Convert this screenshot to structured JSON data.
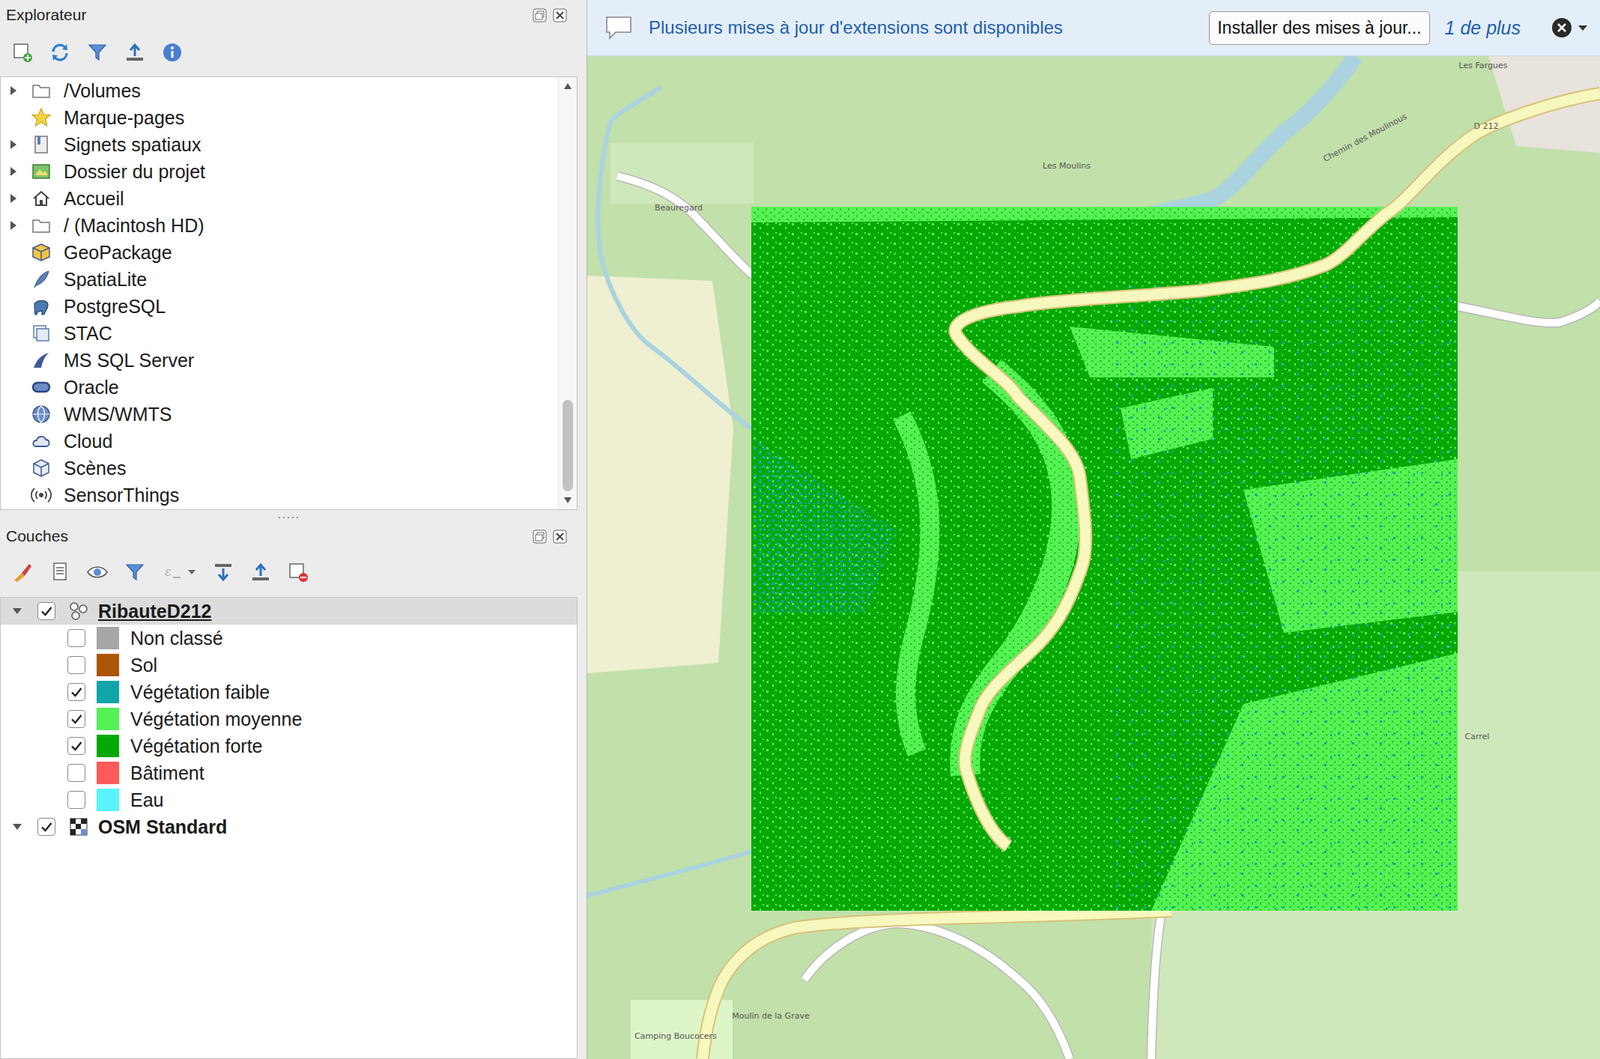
{
  "notification": {
    "message": "Plusieurs mises à jour d'extensions sont disponibles",
    "button": "Installer des mises à jour...",
    "more": "1 de plus"
  },
  "explorer": {
    "title": "Explorateur",
    "items": [
      {
        "label": "/Volumes",
        "expandable": true
      },
      {
        "label": "Marque-pages",
        "expandable": false
      },
      {
        "label": "Signets spatiaux",
        "expandable": true
      },
      {
        "label": "Dossier du projet",
        "expandable": true
      },
      {
        "label": "Accueil",
        "expandable": true
      },
      {
        "label": "/ (Macintosh HD)",
        "expandable": true
      },
      {
        "label": "GeoPackage",
        "expandable": false
      },
      {
        "label": "SpatiaLite",
        "expandable": false
      },
      {
        "label": "PostgreSQL",
        "expandable": false
      },
      {
        "label": "STAC",
        "expandable": false
      },
      {
        "label": "MS SQL Server",
        "expandable": false
      },
      {
        "label": "Oracle",
        "expandable": false
      },
      {
        "label": "WMS/WMTS",
        "expandable": false
      },
      {
        "label": "Cloud",
        "expandable": false
      },
      {
        "label": "Scènes",
        "expandable": false
      },
      {
        "label": "SensorThings",
        "expandable": false
      }
    ],
    "scrollbar": {
      "offset": 0.77,
      "size": 0.23
    }
  },
  "layers_panel": {
    "title": "Couches"
  },
  "layers": [
    {
      "name": "RibauteD212",
      "checked": true,
      "expanded": true,
      "selected": true,
      "current": true,
      "classes": [
        {
          "name": "Non classé",
          "checked": false,
          "color": "#a6a6a6"
        },
        {
          "name": "Sol",
          "checked": false,
          "color": "#ab5607"
        },
        {
          "name": "Végétation faible",
          "checked": true,
          "color": "#10a5a8"
        },
        {
          "name": "Végétation moyenne",
          "checked": true,
          "color": "#55f255"
        },
        {
          "name": "Végétation forte",
          "checked": true,
          "color": "#06a806"
        },
        {
          "name": "Bâtiment",
          "checked": false,
          "color": "#ff5a5a"
        },
        {
          "name": "Eau",
          "checked": false,
          "color": "#5af4ff"
        }
      ]
    },
    {
      "name": "OSM Standard",
      "checked": true,
      "expanded": true,
      "selected": false,
      "current": false,
      "classes": []
    }
  ],
  "map": {
    "labels": [
      "Les Fargues",
      "D 212",
      "Chemin des Moulinous",
      "Les Moulins",
      "Beauregard",
      "Carrel",
      "Moulin de la Grave",
      "Camping Boucocers"
    ]
  }
}
